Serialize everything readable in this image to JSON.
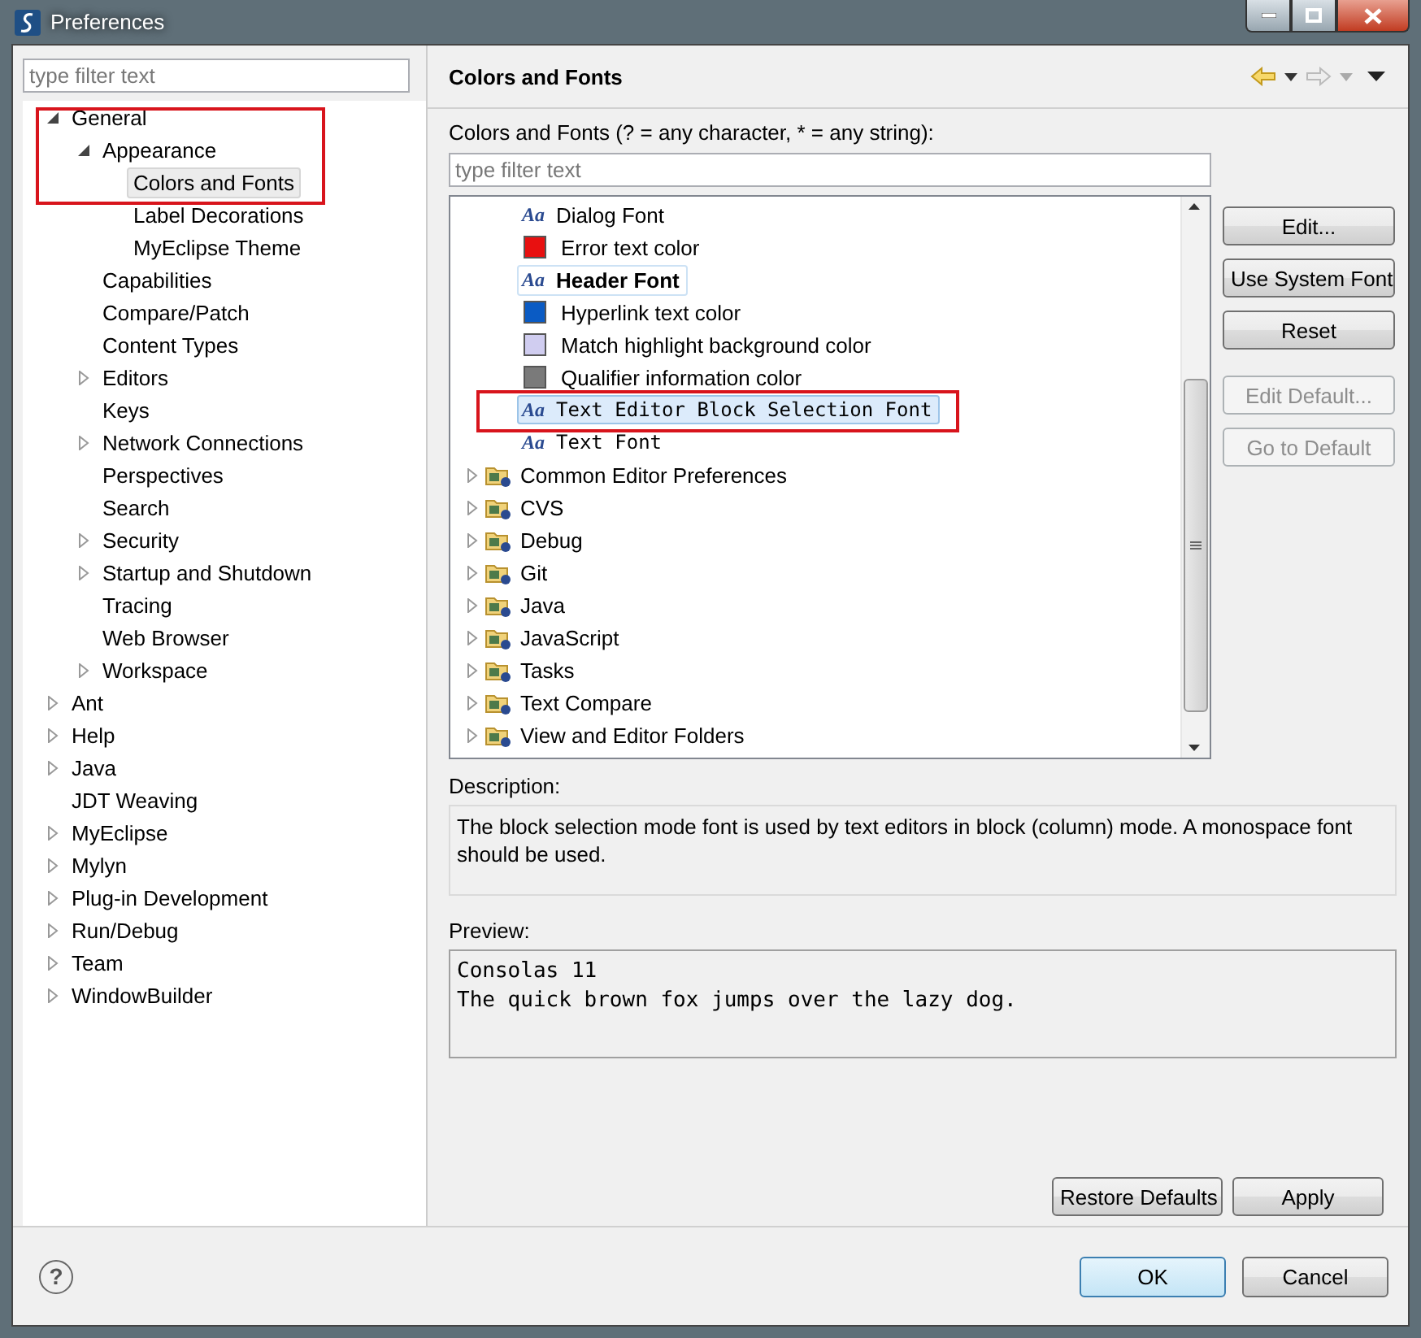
{
  "window": {
    "title": "Preferences"
  },
  "sidebar": {
    "filter": {
      "placeholder": "type filter text"
    },
    "tree": [
      {
        "label": "General",
        "expanded": true,
        "selected": false,
        "annotated": true,
        "children": [
          {
            "label": "Appearance",
            "expanded": true,
            "selected": false,
            "children": [
              {
                "label": "Colors and Fonts",
                "selected": true
              },
              {
                "label": "Label Decorations",
                "selected": false
              },
              {
                "label": "MyEclipse Theme",
                "selected": false
              }
            ]
          },
          {
            "label": "Capabilities",
            "selected": false
          },
          {
            "label": "Compare/Patch",
            "selected": false
          },
          {
            "label": "Content Types",
            "selected": false
          },
          {
            "label": "Editors",
            "expanded": false,
            "selected": false
          },
          {
            "label": "Keys",
            "selected": false
          },
          {
            "label": "Network Connections",
            "expanded": false,
            "selected": false
          },
          {
            "label": "Perspectives",
            "selected": false
          },
          {
            "label": "Search",
            "selected": false
          },
          {
            "label": "Security",
            "expanded": false,
            "selected": false
          },
          {
            "label": "Startup and Shutdown",
            "expanded": false,
            "selected": false
          },
          {
            "label": "Tracing",
            "selected": false
          },
          {
            "label": "Web Browser",
            "selected": false
          },
          {
            "label": "Workspace",
            "expanded": false,
            "selected": false
          }
        ]
      },
      {
        "label": "Ant",
        "expanded": false,
        "selected": false
      },
      {
        "label": "Help",
        "expanded": false,
        "selected": false
      },
      {
        "label": "Java",
        "expanded": false,
        "selected": false
      },
      {
        "label": "JDT Weaving",
        "selected": false
      },
      {
        "label": "MyEclipse",
        "expanded": false,
        "selected": false
      },
      {
        "label": "Mylyn",
        "expanded": false,
        "selected": false
      },
      {
        "label": "Plug-in Development",
        "expanded": false,
        "selected": false
      },
      {
        "label": "Run/Debug",
        "expanded": false,
        "selected": false
      },
      {
        "label": "Team",
        "expanded": false,
        "selected": false
      },
      {
        "label": "WindowBuilder",
        "expanded": false,
        "selected": false
      }
    ]
  },
  "page": {
    "title": "Colors and Fonts",
    "filter_label": "Colors and Fonts (? = any character, * = any string):",
    "filter": {
      "placeholder": "type filter text"
    },
    "items": [
      {
        "kind": "font",
        "icon": "Aa",
        "label": "Dialog Font",
        "selected": false,
        "highlighted": false
      },
      {
        "kind": "color",
        "color": "#e81010",
        "label": "Error text color",
        "selected": false,
        "highlighted": false
      },
      {
        "kind": "bold-font",
        "icon": "Aa",
        "label": "Header Font",
        "selected": false,
        "highlighted": true
      },
      {
        "kind": "color",
        "color": "#0a5bc4",
        "label": "Hyperlink text color",
        "selected": false,
        "highlighted": false
      },
      {
        "kind": "color",
        "color": "#d0cdf0",
        "label": "Match highlight background color",
        "selected": false,
        "highlighted": false
      },
      {
        "kind": "color",
        "color": "#7a7a7a",
        "label": "Qualifier information color",
        "selected": false,
        "highlighted": false
      },
      {
        "kind": "mono-font",
        "icon": "Aa",
        "label": "Text Editor Block Selection Font",
        "selected": true,
        "highlighted": false,
        "annotated": true
      },
      {
        "kind": "mono-font",
        "icon": "Aa",
        "label": "Text Font",
        "selected": false,
        "highlighted": false
      },
      {
        "kind": "category",
        "label": "Common Editor Preferences",
        "expanded": false,
        "selected": false
      },
      {
        "kind": "category",
        "label": "CVS",
        "expanded": false,
        "selected": false
      },
      {
        "kind": "category",
        "label": "Debug",
        "expanded": false,
        "selected": false
      },
      {
        "kind": "category",
        "label": "Git",
        "expanded": false,
        "selected": false
      },
      {
        "kind": "category",
        "label": "Java",
        "expanded": false,
        "selected": false
      },
      {
        "kind": "category",
        "label": "JavaScript",
        "expanded": false,
        "selected": false
      },
      {
        "kind": "category",
        "label": "Tasks",
        "expanded": false,
        "selected": false
      },
      {
        "kind": "category",
        "label": "Text Compare",
        "expanded": false,
        "selected": false
      },
      {
        "kind": "category",
        "label": "View and Editor Folders",
        "expanded": false,
        "selected": false
      }
    ],
    "side_buttons": [
      {
        "label": "Edit...",
        "disabled": false
      },
      {
        "label": "Use System Font",
        "disabled": false
      },
      {
        "label": "Reset",
        "disabled": false
      },
      {
        "label": "Edit Default...",
        "disabled": true
      },
      {
        "label": "Go to Default",
        "disabled": true
      }
    ],
    "description_label": "Description:",
    "description": "The block selection mode font is used by text editors in block (column) mode. A monospace font should be used.",
    "preview_label": "Preview:",
    "preview_lines": [
      "Consolas 11",
      "The quick brown fox jumps over the lazy dog."
    ],
    "buttons": [
      "Restore Defaults",
      "Apply"
    ]
  },
  "footer": {
    "help_icon": "?",
    "buttons": [
      {
        "label": "OK",
        "default": true
      },
      {
        "label": "Cancel",
        "default": false
      }
    ]
  }
}
